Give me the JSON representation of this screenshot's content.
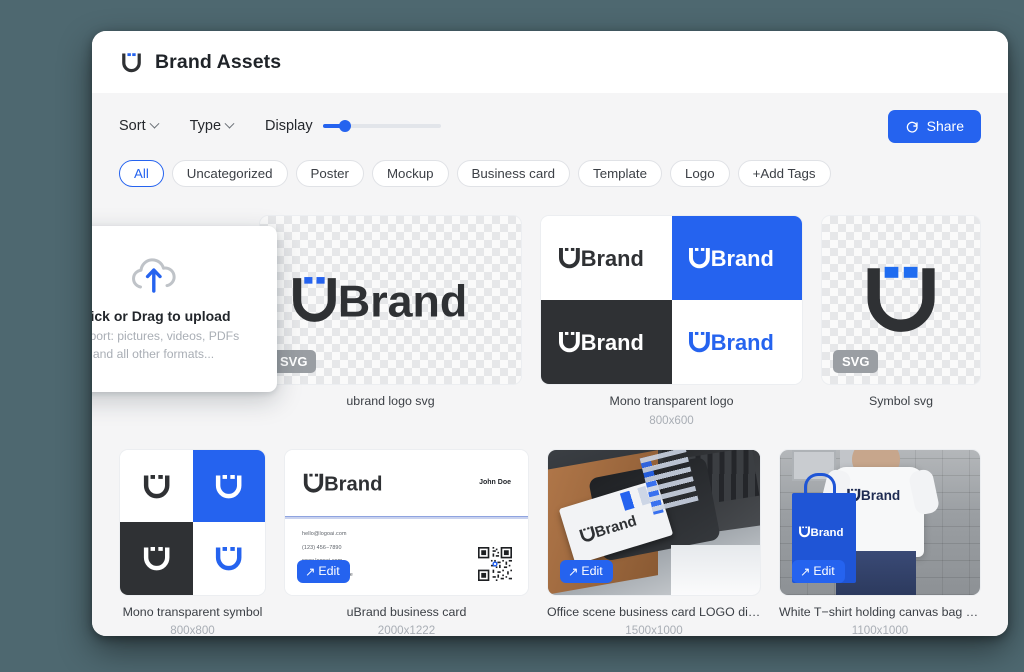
{
  "header": {
    "title": "Brand Assets",
    "logo_icon": "ubrand-u-logo-icon"
  },
  "toolbar": {
    "sort_label": "Sort",
    "type_label": "Type",
    "display_label": "Display",
    "slider_value": 17,
    "share_label": "Share",
    "share_icon": "share-circle-arrow-icon"
  },
  "tags": [
    {
      "label": "All",
      "active": true
    },
    {
      "label": "Uncategorized",
      "active": false
    },
    {
      "label": "Poster",
      "active": false
    },
    {
      "label": "Mockup",
      "active": false
    },
    {
      "label": "Business card",
      "active": false
    },
    {
      "label": "Template",
      "active": false
    },
    {
      "label": "Logo",
      "active": false
    },
    {
      "label": "+Add Tags",
      "active": false
    }
  ],
  "upload": {
    "icon": "cloud-upload-icon",
    "title": "Click or Drag to upload",
    "subtitle_line1": "Support: pictures, videos, PDFs",
    "subtitle_line2": "and all other formats..."
  },
  "assets": [
    {
      "name": "ubrand logo svg",
      "dimensions": "",
      "badge": "SVG",
      "action": ""
    },
    {
      "name": "Mono transparent logo",
      "dimensions": "800x600",
      "badge": "",
      "action": ""
    },
    {
      "name": "Symbol svg",
      "dimensions": "",
      "badge": "SVG",
      "action": ""
    },
    {
      "name": "Mono transparent symbol",
      "dimensions": "800x800",
      "badge": "",
      "action": ""
    },
    {
      "name": "uBrand business card",
      "dimensions": "2000x1222",
      "badge": "",
      "action": "Edit"
    },
    {
      "name": "Office scene business card LOGO display effect",
      "dimensions": "1500x1000",
      "badge": "",
      "action": "Edit"
    },
    {
      "name": "White T−shirt holding canvas bag displ...",
      "dimensions": "1100x1000",
      "badge": "",
      "action": "Edit"
    }
  ],
  "business_card": {
    "wordmark": "Brand",
    "person_name": "John Doe",
    "email": "hello@logoai.com",
    "phone": "(123) 456−7890",
    "website": "www.logoai.com",
    "address": "Address, City., State"
  },
  "logo_text": "Brand",
  "colors": {
    "accent": "#2563ef",
    "page_background": "#4e6870",
    "panel_background": "#f5f5f6",
    "dark": "#2f3134",
    "badge_gray": "#9a9ea3"
  }
}
